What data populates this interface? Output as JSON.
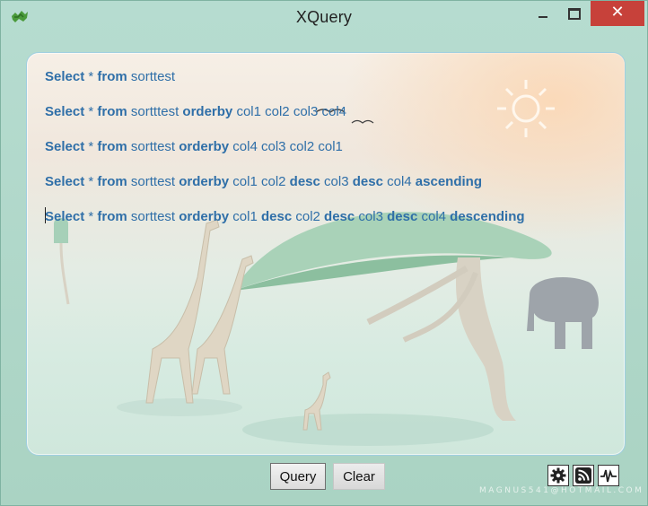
{
  "window": {
    "title": "XQuery",
    "close_glyph": "✕"
  },
  "query": {
    "lines": [
      [
        {
          "t": "Select",
          "kw": true
        },
        {
          "t": " * ",
          "kw": false
        },
        {
          "t": "from",
          "kw": true
        },
        {
          "t": " sorttest",
          "kw": false
        }
      ],
      [
        {
          "t": "Select",
          "kw": true
        },
        {
          "t": " * ",
          "kw": false
        },
        {
          "t": "from",
          "kw": true
        },
        {
          "t": " sortttest ",
          "kw": false
        },
        {
          "t": "orderby",
          "kw": true
        },
        {
          "t": " col1 col2 col3 col4",
          "kw": false
        }
      ],
      [
        {
          "t": "Select",
          "kw": true
        },
        {
          "t": " * ",
          "kw": false
        },
        {
          "t": "from",
          "kw": true
        },
        {
          "t": " sorttest ",
          "kw": false
        },
        {
          "t": "orderby",
          "kw": true
        },
        {
          "t": " col4 col3 col2 col1",
          "kw": false
        }
      ],
      [
        {
          "t": "Select",
          "kw": true
        },
        {
          "t": " * ",
          "kw": false
        },
        {
          "t": "from",
          "kw": true
        },
        {
          "t": " sorttest ",
          "kw": false
        },
        {
          "t": "orderby",
          "kw": true
        },
        {
          "t": " col1 col2 ",
          "kw": false
        },
        {
          "t": "desc",
          "kw": true
        },
        {
          "t": " col3 ",
          "kw": false
        },
        {
          "t": "desc",
          "kw": true
        },
        {
          "t": " col4 ",
          "kw": false
        },
        {
          "t": "ascending",
          "kw": true
        }
      ],
      [
        {
          "t": "Select",
          "kw": true
        },
        {
          "t": " * ",
          "kw": false
        },
        {
          "t": "from",
          "kw": true
        },
        {
          "t": " sorttest ",
          "kw": false
        },
        {
          "t": "orderby",
          "kw": true
        },
        {
          "t": " col1 ",
          "kw": false
        },
        {
          "t": "desc",
          "kw": true
        },
        {
          "t": " col2 ",
          "kw": false
        },
        {
          "t": "desc",
          "kw": true
        },
        {
          "t": " col3 ",
          "kw": false
        },
        {
          "t": "desc",
          "kw": true
        },
        {
          "t": " col4 ",
          "kw": false
        },
        {
          "t": "descending",
          "kw": true
        }
      ]
    ],
    "text_color": "#2f6fa8"
  },
  "buttons": {
    "query_label": "Query",
    "clear_label": "Clear"
  },
  "tools": [
    {
      "icon": "gear-icon"
    },
    {
      "icon": "rss-icon"
    },
    {
      "icon": "activity-icon"
    }
  ],
  "watermark": "MAGNUS541@HOTMAIL.COM",
  "colors": {
    "close_button": "#c7413a",
    "panel_border": "#9fcfe0",
    "window_bg": "#b6dcd0"
  }
}
